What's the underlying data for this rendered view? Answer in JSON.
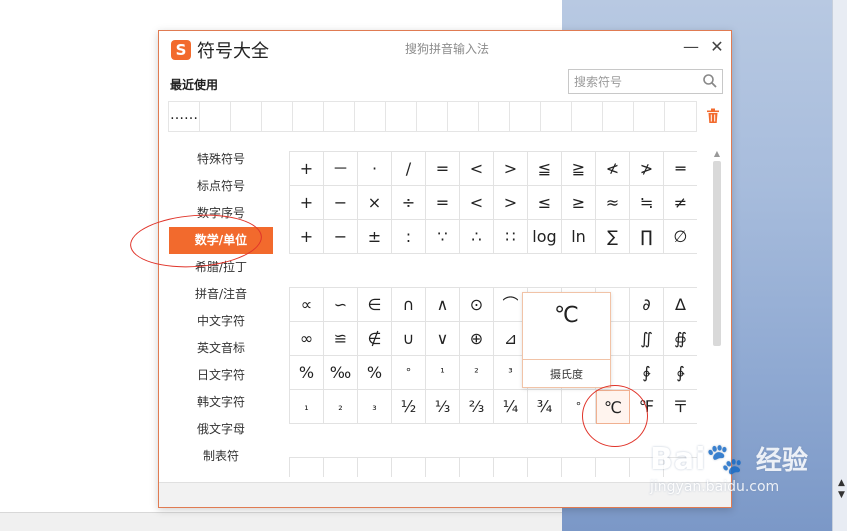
{
  "dialog": {
    "title": "符号大全",
    "subtitle": "搜狗拼音输入法",
    "app_logo_letter": "S",
    "minimize_label": "—",
    "close_label": "✕"
  },
  "recent": {
    "label": "最近使用",
    "items": [
      "……",
      "",
      "",
      "",
      "",
      "",
      "",
      "",
      "",
      "",
      "",
      "",
      "",
      "",
      "",
      "",
      ""
    ]
  },
  "search": {
    "placeholder": "搜索符号",
    "value": ""
  },
  "sidebar": {
    "items": [
      {
        "label": "特殊符号",
        "active": false
      },
      {
        "label": "标点符号",
        "active": false
      },
      {
        "label": "数字序号",
        "active": false
      },
      {
        "label": "数学/单位",
        "active": true
      },
      {
        "label": "希腊/拉丁",
        "active": false
      },
      {
        "label": "拼音/注音",
        "active": false
      },
      {
        "label": "中文字符",
        "active": false
      },
      {
        "label": "英文音标",
        "active": false
      },
      {
        "label": "日文字符",
        "active": false
      },
      {
        "label": "韩文字符",
        "active": false
      },
      {
        "label": "俄文字母",
        "active": false
      },
      {
        "label": "制表符",
        "active": false
      }
    ]
  },
  "grid1": [
    [
      "+",
      "－",
      "·",
      "/",
      "=",
      "<",
      ">",
      "≦",
      "≧",
      "≮",
      "≯",
      "═"
    ],
    [
      "+",
      "−",
      "×",
      "÷",
      "=",
      "<",
      ">",
      "≤",
      "≥",
      "≈",
      "≒",
      "≠"
    ],
    [
      "+",
      "−",
      "±",
      ":",
      "∵",
      "∴",
      "∷",
      "log",
      "ln",
      "∑",
      "∏",
      "∅"
    ]
  ],
  "grid2": [
    [
      "∝",
      "∽",
      "∈",
      "∩",
      "∧",
      "⊙",
      "⌒",
      "",
      "",
      "",
      "∂",
      "∆"
    ],
    [
      "∞",
      "≌",
      "∉",
      "∪",
      "∨",
      "⊕",
      "⊿",
      "",
      "",
      "",
      "∬",
      "∯"
    ],
    [
      "%",
      "‰",
      "%",
      "°",
      "¹",
      "²",
      "³",
      "",
      "",
      "",
      "∲",
      "∳"
    ],
    [
      "₁",
      "₂",
      "₃",
      "½",
      "⅓",
      "⅔",
      "¼",
      "¾",
      "°",
      "℃",
      "℉",
      "〒"
    ]
  ],
  "grid3": [
    [
      "",
      "",
      "",
      "",
      "",
      "",
      "",
      "",
      "",
      "",
      "",
      ""
    ]
  ],
  "preview": {
    "char": "℃",
    "name": "摄氏度"
  },
  "watermark": {
    "logo": "Bai🐾",
    "cn": "经验",
    "url": "jingyan.baidu.com"
  },
  "colors": {
    "accent": "#f26a2d",
    "annotation": "#e0342a",
    "border": "#e2e2e2"
  },
  "icons": {
    "search": "search-icon",
    "trash": "trash-icon",
    "minimize": "minimize-icon",
    "close": "close-icon"
  }
}
